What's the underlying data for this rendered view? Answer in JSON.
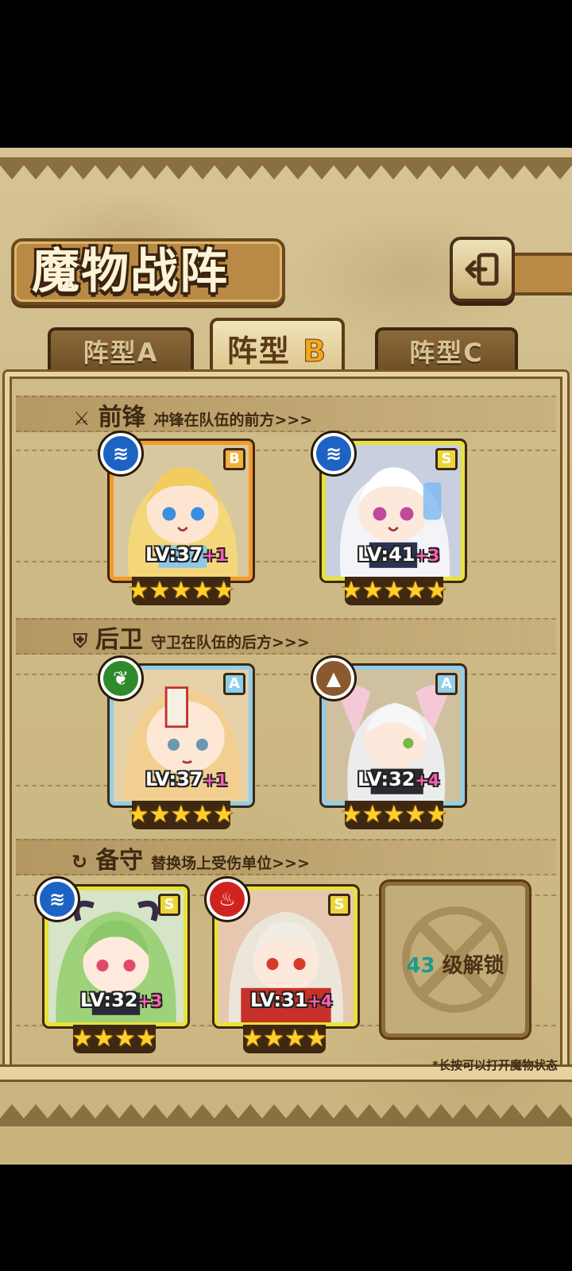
{
  "title": "魔物战阵",
  "tabs": [
    {
      "prefix": "阵型",
      "letter": "A",
      "active": false
    },
    {
      "prefix": "阵型",
      "letter": "B",
      "active": true
    },
    {
      "prefix": "阵型",
      "letter": "C",
      "active": false
    }
  ],
  "sections": {
    "front": {
      "title": "前锋",
      "desc": "冲锋在队伍的前方>>>"
    },
    "back": {
      "title": "后卫",
      "desc": "守卫在队伍的后方>>>"
    },
    "reserve": {
      "title": "备守",
      "desc": "替换场上受伤单位>>>"
    }
  },
  "cards": [
    {
      "element": "water-icon",
      "rank": "B",
      "lv": "LV:37",
      "plus": "+1",
      "stars": "★★★★★",
      "color": "#f59a2a"
    },
    {
      "element": "water-icon",
      "rank": "S",
      "lv": "LV:41",
      "plus": "+3",
      "stars": "★★★★★",
      "color": "#e8e23a"
    },
    {
      "element": "leaf-icon",
      "rank": "A",
      "lv": "LV:37",
      "plus": "+1",
      "stars": "★★★★★",
      "color": "#8ecfe9"
    },
    {
      "element": "earth-icon",
      "rank": "A",
      "lv": "LV:32",
      "plus": "+4",
      "stars": "★★★★★",
      "color": "#8ecfe9"
    },
    {
      "element": "water-icon",
      "rank": "S",
      "lv": "LV:32",
      "plus": "+3",
      "stars": "★★★★",
      "color": "#e8e23a"
    },
    {
      "element": "fire-icon",
      "rank": "S",
      "lv": "LV:31",
      "plus": "+4",
      "stars": "★★★★",
      "color": "#e8e23a"
    }
  ],
  "locked_slot": {
    "level": "43",
    "text": "级解锁"
  },
  "hint": "*长按可以打开魔物状态"
}
